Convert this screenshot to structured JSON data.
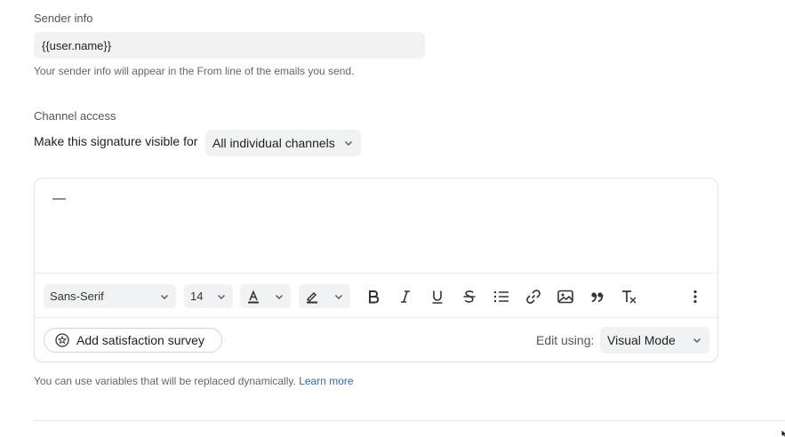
{
  "sender": {
    "label": "Sender info",
    "value": "{{user.name}}",
    "helper": "Your sender info will appear in the From line of the emails you send."
  },
  "channel": {
    "label": "Channel access",
    "row_label": "Make this signature visible for",
    "selected": "All individual channels"
  },
  "editor": {
    "content": "—",
    "toolbar": {
      "font_family": "Sans-Serif",
      "font_size": "14",
      "buttons": [
        "text-color",
        "highlight",
        "bold",
        "italic",
        "underline",
        "strikethrough",
        "bulleted-list",
        "link",
        "image",
        "quote",
        "clear-formatting",
        "more"
      ]
    },
    "survey_button": "Add satisfaction survey",
    "edit_label": "Edit using:",
    "edit_mode": "Visual Mode"
  },
  "footer": {
    "helper": "You can use variables that will be replaced dynamically.",
    "link": "Learn more"
  },
  "colors": {
    "link": "#2b6cb0",
    "field_bg": "#f1f2f3",
    "border": "#e2e3e5"
  }
}
